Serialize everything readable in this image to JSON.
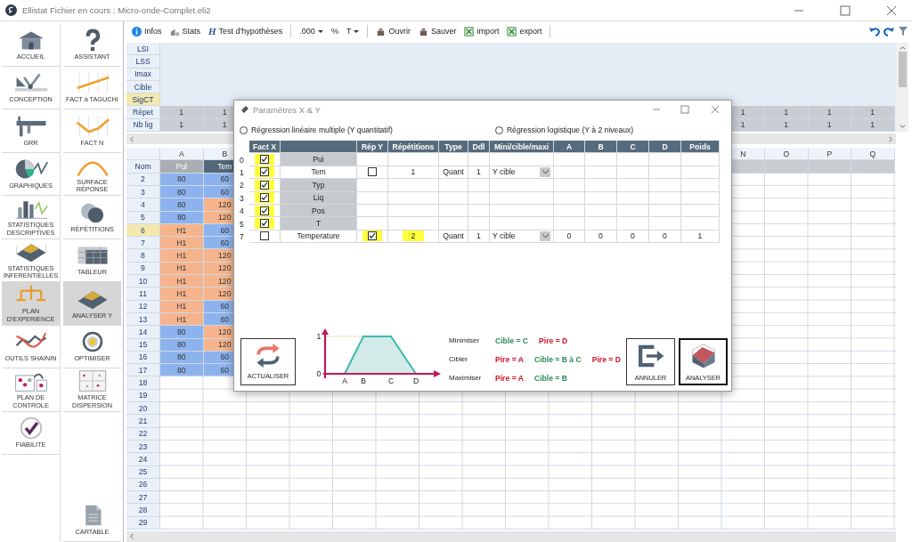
{
  "window": {
    "title": "Ellistat Fichier en cours : Micro-onde-Complet.eli2"
  },
  "nav": {
    "columns": [
      {
        "items": [
          {
            "label": "ACCUEIL",
            "selected": false
          },
          {
            "label": "CONCEPTION",
            "selected": false
          },
          {
            "label": "GRR",
            "selected": false
          },
          {
            "label": "GRAPHIQUES",
            "selected": false
          },
          {
            "label": "STATISTIQUES DESCRIPTIVES",
            "selected": false
          },
          {
            "label": "STATISTIQUES INFERENTIELLES",
            "selected": false
          },
          {
            "label": "PLAN D'EXPERIENCE",
            "selected": true
          },
          {
            "label": "OUTILS SHAININ",
            "selected": false
          },
          {
            "label": "PLAN DE CONTROLE",
            "selected": false
          },
          {
            "label": "FIABILITE",
            "selected": false
          }
        ]
      },
      {
        "items": [
          {
            "label": "ASSISTANT",
            "selected": false
          },
          {
            "label": "FACT à TAGUCHI",
            "selected": false
          },
          {
            "label": "FACT N",
            "selected": false
          },
          {
            "label": "SURFACE RÉPONSE",
            "selected": false
          },
          {
            "label": "RÉPÉTITIONS",
            "selected": false
          },
          {
            "label": "TABLEUR",
            "selected": false
          },
          {
            "label": "ANALYSER Y",
            "selected": true
          },
          {
            "label": "OPTIMISER",
            "selected": false
          },
          {
            "label": "MATRICE DISPERSION",
            "selected": false
          }
        ],
        "bottom_items": [
          {
            "label": "CARTABLE",
            "selected": false
          }
        ]
      }
    ]
  },
  "toolbar": {
    "items": [
      {
        "kind": "button",
        "label": "Infos"
      },
      {
        "kind": "button",
        "label": "Stats"
      },
      {
        "kind": "letter-button",
        "letter": "H",
        "label": "Test d'hypothèses"
      },
      {
        "kind": "separator"
      },
      {
        "kind": "dropdown",
        "label": ".000"
      },
      {
        "kind": "plain",
        "label": "%"
      },
      {
        "kind": "dropdown",
        "label": "T"
      },
      {
        "kind": "separator"
      },
      {
        "kind": "button",
        "label": "Ouvrir"
      },
      {
        "kind": "button",
        "label": "Sauver"
      },
      {
        "kind": "button",
        "label": "import"
      },
      {
        "kind": "button",
        "label": "export"
      },
      {
        "kind": "separator"
      }
    ]
  },
  "spec_grid": {
    "rows": [
      {
        "label": "LSI",
        "kind": "limit",
        "current": false
      },
      {
        "label": "LSS",
        "kind": "limit",
        "current": false
      },
      {
        "label": "Imax",
        "kind": "limit",
        "current": false
      },
      {
        "label": "Cible",
        "kind": "limit",
        "current": false
      },
      {
        "label": "SigCT",
        "kind": "limit",
        "current": true
      },
      {
        "label": "Répet",
        "kind": "count",
        "current": false,
        "values": [
          "1",
          "1",
          "1",
          "1",
          "1",
          "1"
        ]
      },
      {
        "label": "Nb lig",
        "kind": "count",
        "current": false,
        "values": [
          "1",
          "1",
          "1",
          "1",
          "1",
          "1"
        ]
      }
    ]
  },
  "sheet": {
    "name_label": "Nom",
    "columns": [
      {
        "letter": "A",
        "name": "Pul",
        "color": "#a9aeb3"
      },
      {
        "letter": "B",
        "name": "Tem",
        "color": "#52677a"
      },
      {
        "letter": "N"
      },
      {
        "letter": "O"
      },
      {
        "letter": "P"
      },
      {
        "letter": "Q"
      }
    ],
    "rows": [
      {
        "number": "2",
        "current": false,
        "cells": [
          {
            "text": "80",
            "high": false
          },
          {
            "text": "60",
            "high": false
          }
        ]
      },
      {
        "number": "3",
        "current": false,
        "cells": [
          {
            "text": "80",
            "high": false
          },
          {
            "text": "60",
            "high": false
          }
        ]
      },
      {
        "number": "4",
        "current": false,
        "cells": [
          {
            "text": "80",
            "high": false
          },
          {
            "text": "120",
            "high": true
          }
        ]
      },
      {
        "number": "5",
        "current": false,
        "cells": [
          {
            "text": "80",
            "high": false
          },
          {
            "text": "120",
            "high": true
          }
        ]
      },
      {
        "number": "6",
        "current": true,
        "cells": [
          {
            "text": "H1",
            "high": true
          },
          {
            "text": "60",
            "high": false
          }
        ]
      },
      {
        "number": "7",
        "current": false,
        "cells": [
          {
            "text": "H1",
            "high": true
          },
          {
            "text": "60",
            "high": false
          }
        ]
      },
      {
        "number": "8",
        "current": false,
        "cells": [
          {
            "text": "H1",
            "high": true
          },
          {
            "text": "120",
            "high": true
          }
        ]
      },
      {
        "number": "9",
        "current": false,
        "cells": [
          {
            "text": "H1",
            "high": true
          },
          {
            "text": "120",
            "high": true
          }
        ]
      },
      {
        "number": "10",
        "current": false,
        "cells": [
          {
            "text": "H1",
            "high": true
          },
          {
            "text": "120",
            "high": true
          }
        ]
      },
      {
        "number": "11",
        "current": false,
        "cells": [
          {
            "text": "H1",
            "high": true
          },
          {
            "text": "120",
            "high": true
          }
        ]
      },
      {
        "number": "12",
        "current": false,
        "cells": [
          {
            "text": "H1",
            "high": true
          },
          {
            "text": "60",
            "high": false
          }
        ]
      },
      {
        "number": "13",
        "current": false,
        "cells": [
          {
            "text": "H1",
            "high": true
          },
          {
            "text": "60",
            "high": false
          }
        ]
      },
      {
        "number": "14",
        "current": false,
        "cells": [
          {
            "text": "80",
            "high": false
          },
          {
            "text": "120",
            "high": true
          }
        ]
      },
      {
        "number": "15",
        "current": false,
        "cells": [
          {
            "text": "80",
            "high": false
          },
          {
            "text": "120",
            "high": true
          }
        ]
      },
      {
        "number": "16",
        "current": false,
        "cells": [
          {
            "text": "80",
            "high": false
          },
          {
            "text": "60",
            "high": false
          }
        ]
      },
      {
        "number": "17",
        "current": false,
        "cells": [
          {
            "text": "80",
            "high": false
          },
          {
            "text": "60",
            "high": false
          }
        ]
      },
      {
        "number": "18",
        "current": false
      },
      {
        "number": "19",
        "current": false
      },
      {
        "number": "20",
        "current": false
      },
      {
        "number": "21",
        "current": false
      },
      {
        "number": "22",
        "current": false
      },
      {
        "number": "23",
        "current": false
      },
      {
        "number": "24",
        "current": false
      },
      {
        "number": "25",
        "current": false
      },
      {
        "number": "26",
        "current": false
      },
      {
        "number": "27",
        "current": false
      },
      {
        "number": "28",
        "current": false
      },
      {
        "number": "29",
        "current": false
      }
    ]
  },
  "dialog": {
    "title": "Paramètres X & Y",
    "options": [
      {
        "label": "Régression linéaire multiple (Y quantitatif)",
        "selected": false
      },
      {
        "label": "Régression logistique (Y à 2 niveaux)",
        "selected": false
      }
    ],
    "table": {
      "columns": [
        "Fact X",
        "Rép Y",
        "Répétitions",
        "Type",
        "Ddl",
        "Mini/cible/maxi",
        "A",
        "B",
        "C",
        "D",
        "Poids"
      ],
      "rows": [
        {
          "index": "0",
          "fact_x": true,
          "highlighted": true,
          "name": "Pui",
          "kind": "factor"
        },
        {
          "index": "1",
          "fact_x": true,
          "highlighted": true,
          "name": "Tem",
          "kind": "response",
          "rep_y": false,
          "rep_y_highlighted": false,
          "repetitions": "1",
          "repetitions_highlighted": false,
          "type": "Quant",
          "ddl": "1",
          "target": "Y cible"
        },
        {
          "index": "2",
          "fact_x": true,
          "highlighted": true,
          "name": "Typ",
          "kind": "factor"
        },
        {
          "index": "3",
          "fact_x": true,
          "highlighted": true,
          "name": "Liq",
          "kind": "factor"
        },
        {
          "index": "4",
          "fact_x": true,
          "highlighted": true,
          "name": "Pos",
          "kind": "factor"
        },
        {
          "index": "5",
          "fact_x": true,
          "highlighted": true,
          "name": "T",
          "kind": "factor"
        },
        {
          "index": "7",
          "fact_x": false,
          "highlighted": false,
          "name": "Temperature",
          "kind": "response",
          "rep_y": true,
          "rep_y_highlighted": true,
          "repetitions": "2",
          "repetitions_highlighted": true,
          "type": "Quant",
          "ddl": "1",
          "target": "Y cible",
          "values": [
            "0",
            "0",
            "0",
            "0",
            "1"
          ]
        }
      ]
    },
    "refresh_button": {
      "label": "ACTUALISER"
    },
    "profile": {
      "y_labels": [
        "1",
        "0"
      ],
      "x_labels": [
        "A",
        "B",
        "C",
        "D"
      ]
    },
    "rules": [
      {
        "label": "Minimiser",
        "items": [
          {
            "text": "Cible = C",
            "color": "#2e8b57"
          },
          {
            "text": "Pire = D",
            "color": "#d0142c"
          }
        ]
      },
      {
        "label": "Cibler",
        "items": [
          {
            "text": "Pire = A",
            "color": "#d0142c"
          },
          {
            "text": "Cible = B à C",
            "color": "#2e8b57"
          },
          {
            "text": "Pire = D",
            "color": "#d0142c"
          }
        ]
      },
      {
        "label": "Maximiser",
        "items": [
          {
            "text": "Pire = A",
            "color": "#d0142c"
          },
          {
            "text": "Cible = B",
            "color": "#2e8b57"
          }
        ]
      }
    ],
    "buttons": [
      {
        "label": "ANNULER",
        "selected": false
      },
      {
        "label": "ANALYSER",
        "selected": true
      }
    ]
  }
}
